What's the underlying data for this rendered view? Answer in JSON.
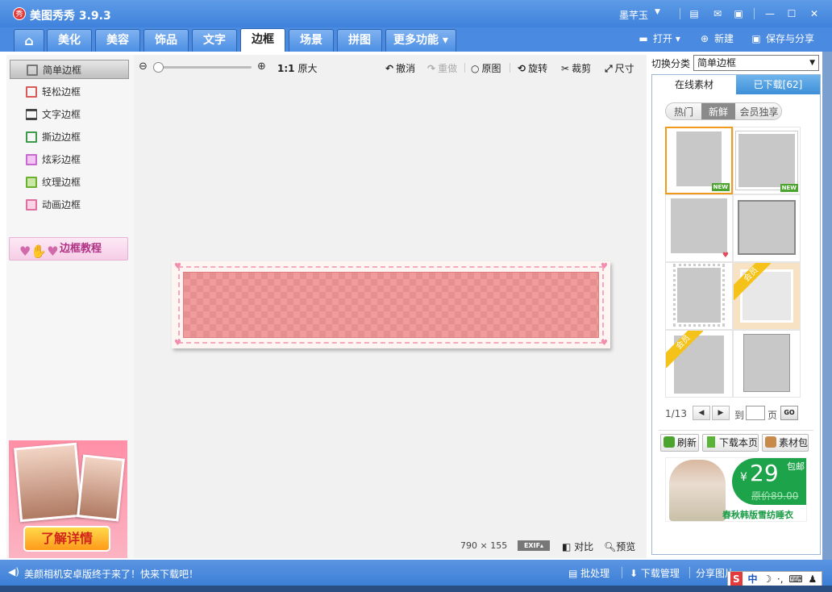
{
  "window": {
    "logo_text": "秀",
    "title": "美图秀秀 3.9.3",
    "user": "墨芊玉"
  },
  "nav": {
    "tabs": [
      {
        "label": "⌂"
      },
      {
        "label": "美化"
      },
      {
        "label": "美容"
      },
      {
        "label": "饰品"
      },
      {
        "label": "文字"
      },
      {
        "label": "边框"
      },
      {
        "label": "场景"
      },
      {
        "label": "拼图"
      },
      {
        "label": "更多功能 ▾"
      }
    ],
    "open": "打开",
    "new": "新建",
    "save": "保存与分享"
  },
  "left": {
    "categories": [
      {
        "label": "简单边框",
        "icon_color": "#555555"
      },
      {
        "label": "轻松边框",
        "icon_color": "#d85a5a"
      },
      {
        "label": "文字边框",
        "icon_color": "#444444"
      },
      {
        "label": "撕边边框",
        "icon_color": "#3c9a4a"
      },
      {
        "label": "炫彩边框",
        "icon_color": "#c66ad0"
      },
      {
        "label": "纹理边框",
        "icon_color": "#6cb030"
      },
      {
        "label": "动画边框",
        "icon_color": "#e070a0"
      }
    ],
    "tutorial": "边框教程",
    "promo_button": "了解详情"
  },
  "toolbar": {
    "original_size_prefix": "1:1",
    "original_size": "原大",
    "undo": "撤消",
    "redo": "重做",
    "original": "原图",
    "rotate": "旋转",
    "crop": "裁剪",
    "resize": "尺寸"
  },
  "canvas": {
    "dimensions": "790 × 155",
    "exif": "EXIF",
    "compare": "对比",
    "preview": "预览"
  },
  "right": {
    "switch_label": "切换分类",
    "category": "简单边框",
    "tab_online": "在线素材",
    "tab_downloaded": "已下载[62]",
    "filters": [
      "热门",
      "新鲜",
      "会员独享"
    ],
    "new_badge": "NEW",
    "vip_badge": "会员",
    "page_info": "1/13",
    "to": "到",
    "page": "页",
    "go": "GO",
    "refresh": "刷新",
    "download_page": "下载本页",
    "material_pack": "素材包",
    "promo": {
      "currency": "¥",
      "price": "29",
      "shipping": "包邮",
      "old_price": "原价89.00",
      "caption": "春秋韩版雪纺睡衣"
    }
  },
  "status": {
    "message": "美颜相机安卓版终于来了！快来下载吧！",
    "batch": "批处理",
    "downloads": "下载管理",
    "share": "分享图片"
  },
  "ime": {
    "brand": "S",
    "mode": "中"
  },
  "colors": {
    "accent_blue": "#3f82dc",
    "selected_border": "#f09b1d",
    "vip_gold": "#f5c21a",
    "new_green": "#4aa42e"
  }
}
